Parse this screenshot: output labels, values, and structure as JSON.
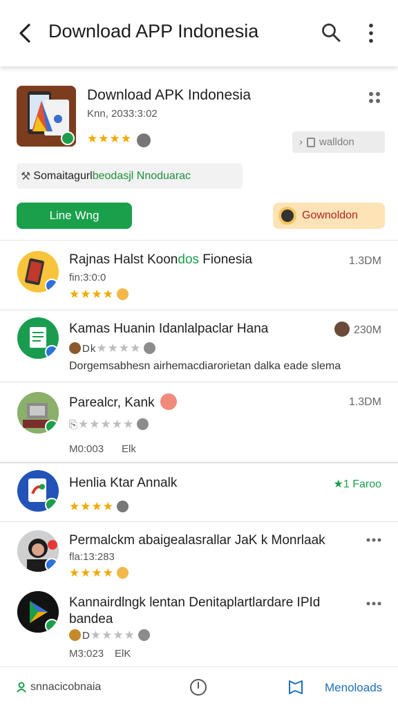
{
  "appbar": {
    "title": "Download APP Indonesia"
  },
  "featured": {
    "title": "Download APK Indonesia",
    "subtitle": "Knn, 2033:3:02",
    "stars": "★★★★",
    "install_label": "walldon",
    "tag_prefix": "Somaitagurl",
    "tag_green": "beodasjl Nnoduarac",
    "primary_button": "Line Wng",
    "secondary_button": "Gownoldon"
  },
  "items": [
    {
      "name_a": "Rajnas Halst Koon",
      "name_b": "dos",
      "name_c": " Fionesia",
      "sub": "fin:3:0:0",
      "stars": "★★★★",
      "right": "1.3DM"
    },
    {
      "name": "Kamas Huanin Idanlalpaclar Hana",
      "stars_prefix": "Dk",
      "stars": "★★★★",
      "desc": "Dorgemsabhesn airhemacdiarorietan dalka eade slema",
      "right": "230M"
    },
    {
      "name": "Parealcr, Kank",
      "stars": "★★★★★",
      "meta_a": "M0:003",
      "meta_b": "Elk",
      "right": "1.3DM"
    },
    {
      "name": "Henlia Ktar Annalk",
      "stars": "★★★★",
      "right": "★1 Faroo"
    },
    {
      "name": "Permalckm abaigealasrallar JaK k Monrlaak",
      "sub": "fla:13:283",
      "stars": "★★★★"
    },
    {
      "name_line1": "Kannairdlngk lentan Denitaplartlardare IPId",
      "name_line2": "bandea",
      "stars_prefix": "D",
      "stars": "★★★★",
      "meta_a": "M3:023",
      "meta_b": "ElK"
    }
  ],
  "bottom_nav": {
    "left_label": "snnacicobnaia",
    "right_label": "Menoloads"
  },
  "colors": {
    "accent_green": "#1aa04b",
    "accent_blue": "#1c6fb8",
    "star": "#f2a900",
    "orange_btn": "#fde3b6"
  }
}
